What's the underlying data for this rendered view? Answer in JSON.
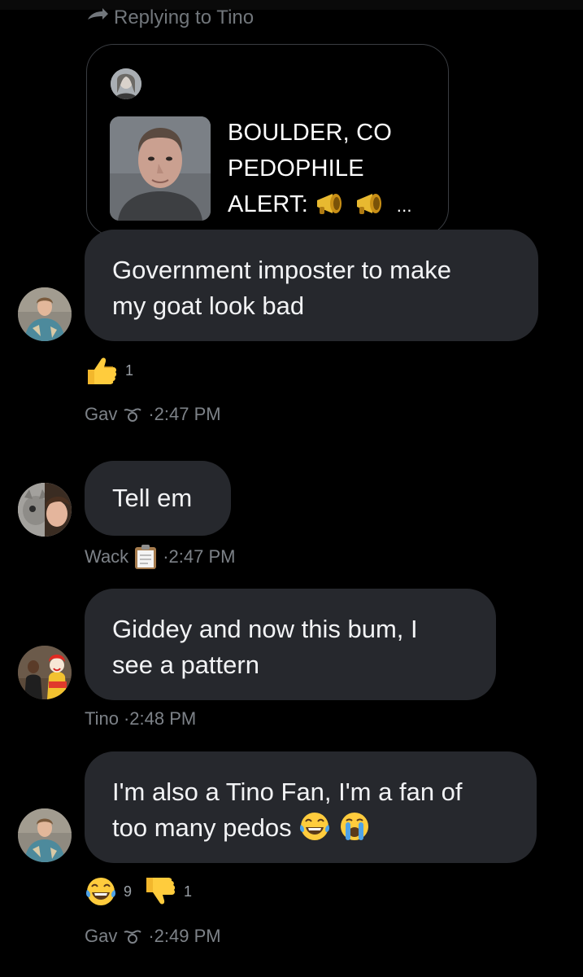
{
  "reply_header": {
    "text": "Replying to Tino"
  },
  "quoted_post": {
    "text_line1": "BOULDER, CO",
    "text_line2": "PEDOPHILE",
    "text_line3": "ALERT:",
    "ellipsis": "..."
  },
  "messages": [
    {
      "text_line1": "Government imposter to make",
      "text_line2": "my goat look bad",
      "reaction_thumbs_up_count": "1",
      "author": "Gav",
      "time": "·2:47 PM"
    },
    {
      "text_line1": "Tell em",
      "author": "Wack",
      "time": "·2:47 PM"
    },
    {
      "text_line1": "Giddey and now this bum, I",
      "text_line2": "see a pattern",
      "author": "Tino",
      "time": "·2:48 PM"
    },
    {
      "text_line1": "I'm also a Tino Fan, I'm a fan of",
      "text_line2": "too many pedos",
      "reaction_laugh_count": "9",
      "reaction_thumbs_down_count": "1",
      "author": "Gav",
      "time": "·2:49 PM"
    }
  ],
  "icons": {
    "reply": "reply-arrow-icon",
    "megaphone": "megaphone-icon",
    "thumbs_up": "thumbs-up-icon",
    "thumbs_down": "thumbs-down-icon",
    "laugh": "laughing-crying-icon",
    "cry": "loudly-crying-icon",
    "clipboard": "clipboard-icon",
    "tilde_badge": "tilde-icon"
  },
  "colors": {
    "background": "#000000",
    "bubble": "#26282d",
    "meta_text": "#7d8288"
  }
}
